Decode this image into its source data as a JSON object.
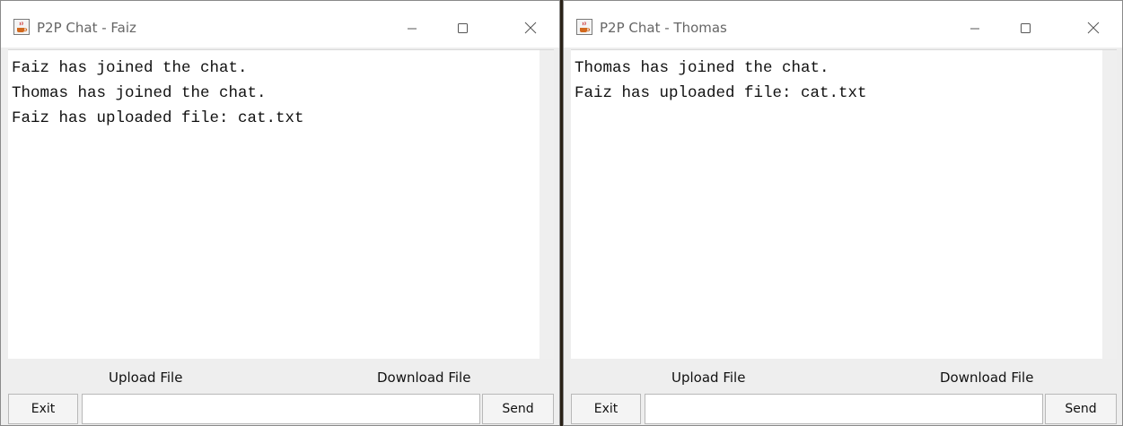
{
  "windows": [
    {
      "title": "P2P Chat - Faiz",
      "messages": [
        "Faiz has joined the chat.",
        "Thomas has joined the chat.",
        "Faiz has uploaded file: cat.txt"
      ],
      "upload_label": "Upload File",
      "download_label": "Download File",
      "exit_label": "Exit",
      "send_label": "Send",
      "input_value": ""
    },
    {
      "title": "P2P Chat - Thomas",
      "messages": [
        "Thomas has joined the chat.",
        "Faiz has uploaded file: cat.txt"
      ],
      "upload_label": "Upload File",
      "download_label": "Download File",
      "exit_label": "Exit",
      "send_label": "Send",
      "input_value": ""
    }
  ],
  "icons": {
    "app": "java-coffee-cup-icon",
    "minimize": "minimize-icon",
    "maximize": "maximize-icon",
    "close": "close-icon"
  },
  "colors": {
    "title_text": "#666666",
    "window_background": "#eeeeee",
    "chat_background": "#ffffff",
    "desktop_background": "#2a2218"
  }
}
